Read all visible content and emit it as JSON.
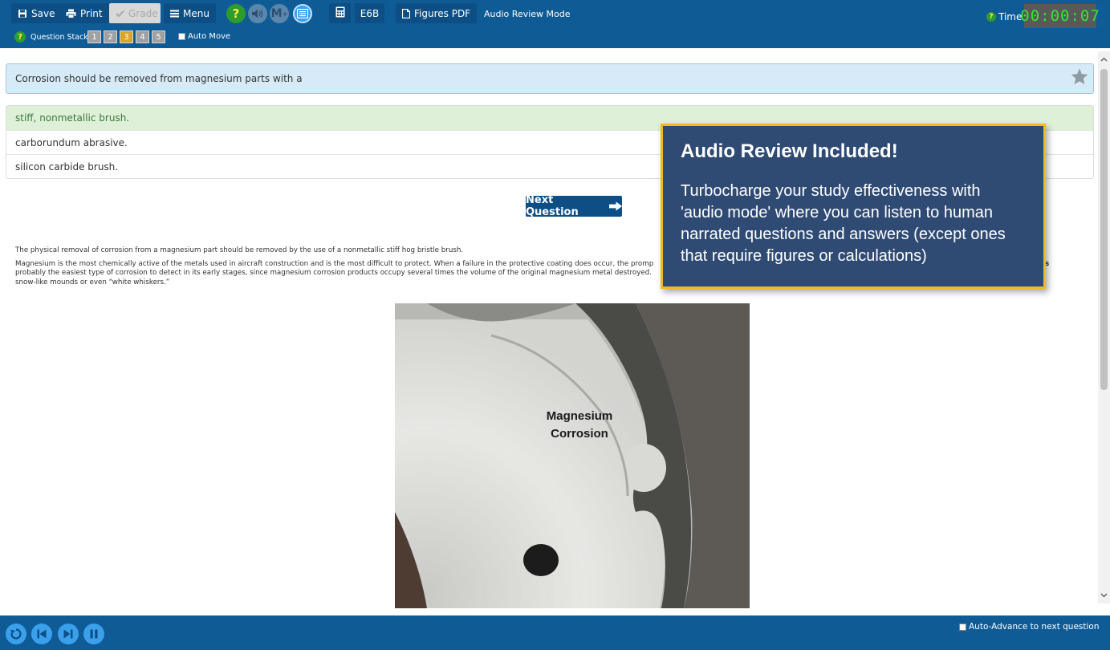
{
  "toolbar": {
    "save_label": "Save",
    "print_label": "Print",
    "grade_label": "Grade",
    "menu_label": "Menu",
    "e6b_label": "E6B",
    "figures_label": "Figures PDF",
    "mode_label": "Audio Review Mode",
    "icons": [
      "save-icon",
      "print-icon",
      "check-icon",
      "menu-icon",
      "help-icon",
      "speaker-icon",
      "markdown-icon",
      "list-icon",
      "calculator-icon",
      "pdf-icon"
    ]
  },
  "question_stack": {
    "label": "Question Stack:",
    "items": [
      "1",
      "2",
      "3",
      "4",
      "5"
    ],
    "active_index": 2,
    "auto_move_label": "Auto Move"
  },
  "timer": {
    "label": "Time",
    "value": "00:00:07"
  },
  "question": {
    "text": "Corrosion should be removed from magnesium parts with a"
  },
  "answers": [
    {
      "text": "stiff, nonmetallic brush.",
      "correct": true
    },
    {
      "text": "carborundum abrasive.",
      "correct": false
    },
    {
      "text": "silicon carbide brush.",
      "correct": false
    }
  ],
  "next_button_label": "Next Question",
  "explanation": {
    "p1": "The physical removal of corrosion from a magnesium part should be removed by the use of a nonmetallic stiff hog bristle brush.",
    "p2a": "Magnesium is the most chemically active of the metals used in aircraft construction and is the most difficult to protect. When a failure in the protective coating does occur, the promp",
    "p2b": "is",
    "p2c": "probably the easiest type of corrosion to detect in its early stages, since magnesium corrosion products occupy several times the volume of the original magnesium metal destroyed.",
    "p2d": "snow-like mounds or even “white whiskers.”"
  },
  "figure": {
    "label_line1": "Magnesium",
    "label_line2": "Corrosion"
  },
  "promo": {
    "title": "Audio Review Included!",
    "body": "Turbocharge your study effectiveness with 'audio mode' where you can listen to human narrated  questions and answers (except ones that require figures or calculations)"
  },
  "bottom": {
    "controls": [
      "replay-icon",
      "previous-icon",
      "next-icon",
      "pause-icon"
    ],
    "auto_advance_label": "Auto-Advance to next question"
  },
  "colors": {
    "header_bg": "#0f5b96",
    "button_bg": "#0d4f85",
    "correct_bg": "#dff0d8",
    "promo_bg": "#2f4b74",
    "promo_border": "#f2b822",
    "timer_text": "#34e534"
  }
}
